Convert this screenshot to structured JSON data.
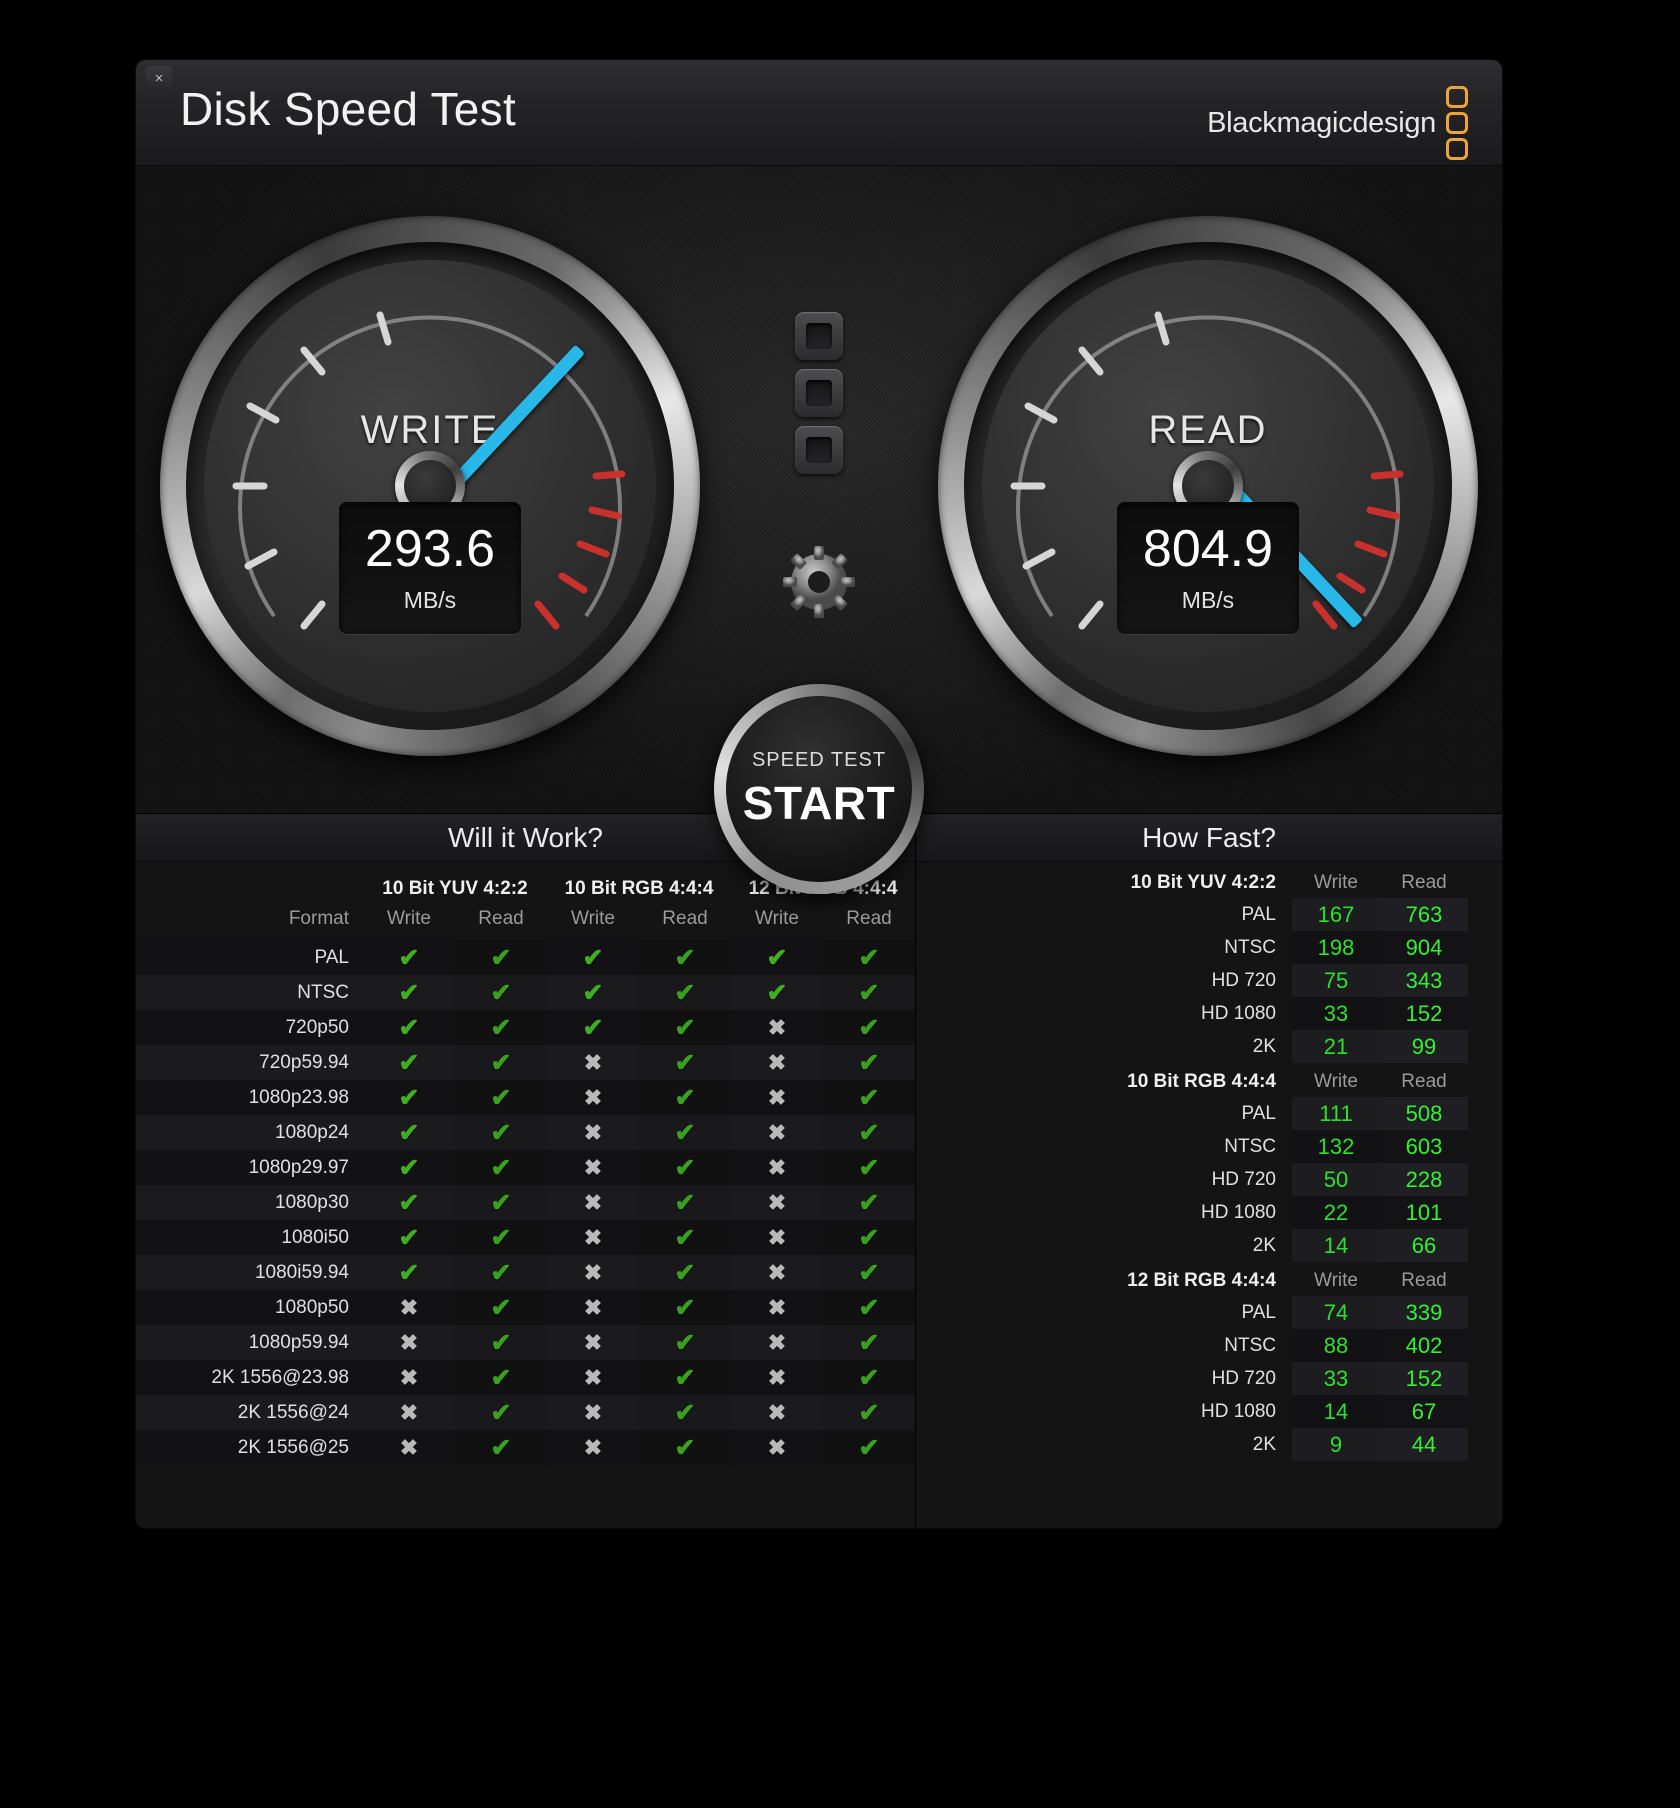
{
  "window": {
    "title": "Disk Speed Test",
    "close_label": "×",
    "brand_text": "Blackmagicdesign"
  },
  "gauges": {
    "write": {
      "label": "WRITE",
      "value": "293.6",
      "unit": "MB/s",
      "needle_angle": -47
    },
    "read": {
      "label": "READ",
      "value": "804.9",
      "unit": "MB/s",
      "needle_angle": 47
    }
  },
  "start_button": {
    "sub_label": "SPEED TEST",
    "main_label": "START"
  },
  "icons": {
    "gear": "gear-icon"
  },
  "colors": {
    "needle": "#27b7e8",
    "accent_orange": "#f0a33a",
    "tick_green": "#3fae22",
    "value_green": "#2ee02e",
    "cross_gray": "#b9b9b9"
  },
  "will_it_work": {
    "header": "Will it Work?",
    "format_label": "Format",
    "groups": [
      "10 Bit YUV 4:2:2",
      "10 Bit RGB 4:4:4",
      "12 Bit RGB 4:4:4"
    ],
    "sub_columns": [
      "Write",
      "Read"
    ],
    "rows": [
      {
        "format": "PAL",
        "marks": [
          true,
          true,
          true,
          true,
          true,
          true
        ]
      },
      {
        "format": "NTSC",
        "marks": [
          true,
          true,
          true,
          true,
          true,
          true
        ]
      },
      {
        "format": "720p50",
        "marks": [
          true,
          true,
          true,
          true,
          false,
          true
        ]
      },
      {
        "format": "720p59.94",
        "marks": [
          true,
          true,
          false,
          true,
          false,
          true
        ]
      },
      {
        "format": "1080p23.98",
        "marks": [
          true,
          true,
          false,
          true,
          false,
          true
        ]
      },
      {
        "format": "1080p24",
        "marks": [
          true,
          true,
          false,
          true,
          false,
          true
        ]
      },
      {
        "format": "1080p29.97",
        "marks": [
          true,
          true,
          false,
          true,
          false,
          true
        ]
      },
      {
        "format": "1080p30",
        "marks": [
          true,
          true,
          false,
          true,
          false,
          true
        ]
      },
      {
        "format": "1080i50",
        "marks": [
          true,
          true,
          false,
          true,
          false,
          true
        ]
      },
      {
        "format": "1080i59.94",
        "marks": [
          true,
          true,
          false,
          true,
          false,
          true
        ]
      },
      {
        "format": "1080p50",
        "marks": [
          false,
          true,
          false,
          true,
          false,
          true
        ]
      },
      {
        "format": "1080p59.94",
        "marks": [
          false,
          true,
          false,
          true,
          false,
          true
        ]
      },
      {
        "format": "2K 1556@23.98",
        "marks": [
          false,
          true,
          false,
          true,
          false,
          true
        ]
      },
      {
        "format": "2K 1556@24",
        "marks": [
          false,
          true,
          false,
          true,
          false,
          true
        ]
      },
      {
        "format": "2K 1556@25",
        "marks": [
          false,
          true,
          false,
          true,
          false,
          true
        ]
      }
    ],
    "tick_glyph": "✔",
    "cross_glyph": "✖"
  },
  "how_fast": {
    "header": "How Fast?",
    "write_label": "Write",
    "read_label": "Read",
    "groups": [
      {
        "title": "10 Bit YUV 4:2:2",
        "rows": [
          {
            "label": "PAL",
            "write": "167",
            "read": "763"
          },
          {
            "label": "NTSC",
            "write": "198",
            "read": "904"
          },
          {
            "label": "HD 720",
            "write": "75",
            "read": "343"
          },
          {
            "label": "HD 1080",
            "write": "33",
            "read": "152"
          },
          {
            "label": "2K",
            "write": "21",
            "read": "99"
          }
        ]
      },
      {
        "title": "10 Bit RGB 4:4:4",
        "rows": [
          {
            "label": "PAL",
            "write": "111",
            "read": "508"
          },
          {
            "label": "NTSC",
            "write": "132",
            "read": "603"
          },
          {
            "label": "HD 720",
            "write": "50",
            "read": "228"
          },
          {
            "label": "HD 1080",
            "write": "22",
            "read": "101"
          },
          {
            "label": "2K",
            "write": "14",
            "read": "66"
          }
        ]
      },
      {
        "title": "12 Bit RGB 4:4:4",
        "rows": [
          {
            "label": "PAL",
            "write": "74",
            "read": "339"
          },
          {
            "label": "NTSC",
            "write": "88",
            "read": "402"
          },
          {
            "label": "HD 720",
            "write": "33",
            "read": "152"
          },
          {
            "label": "HD 1080",
            "write": "14",
            "read": "67"
          },
          {
            "label": "2K",
            "write": "9",
            "read": "44"
          }
        ]
      }
    ]
  }
}
